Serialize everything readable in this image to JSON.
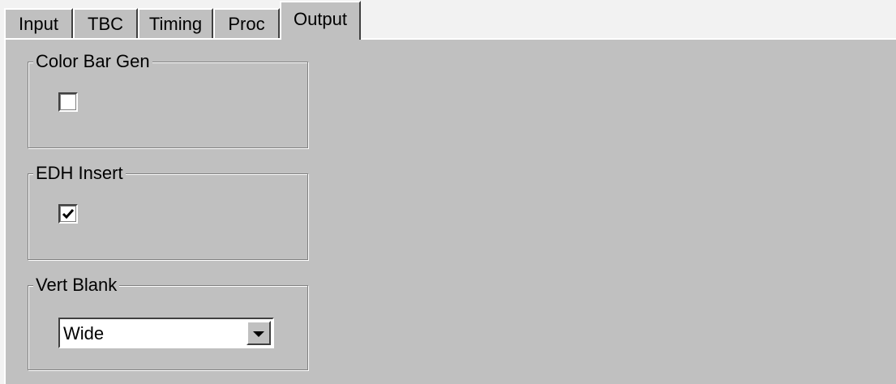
{
  "tabs": [
    {
      "label": "Input",
      "active": false
    },
    {
      "label": "TBC",
      "active": false
    },
    {
      "label": "Timing",
      "active": false
    },
    {
      "label": "Proc",
      "active": false
    },
    {
      "label": "Output",
      "active": true
    }
  ],
  "output": {
    "color_bar_gen": {
      "label": "Color Bar Gen",
      "checked": false
    },
    "edh_insert": {
      "label": "EDH Insert",
      "checked": true
    },
    "vert_blank": {
      "label": "Vert Blank",
      "value": "Wide"
    }
  },
  "icons": {
    "dropdown": "chevron-down-icon",
    "check": "checkmark-icon"
  },
  "colors": {
    "panel_bg": "#c0c0c0",
    "page_bg": "#f2f2f2"
  }
}
